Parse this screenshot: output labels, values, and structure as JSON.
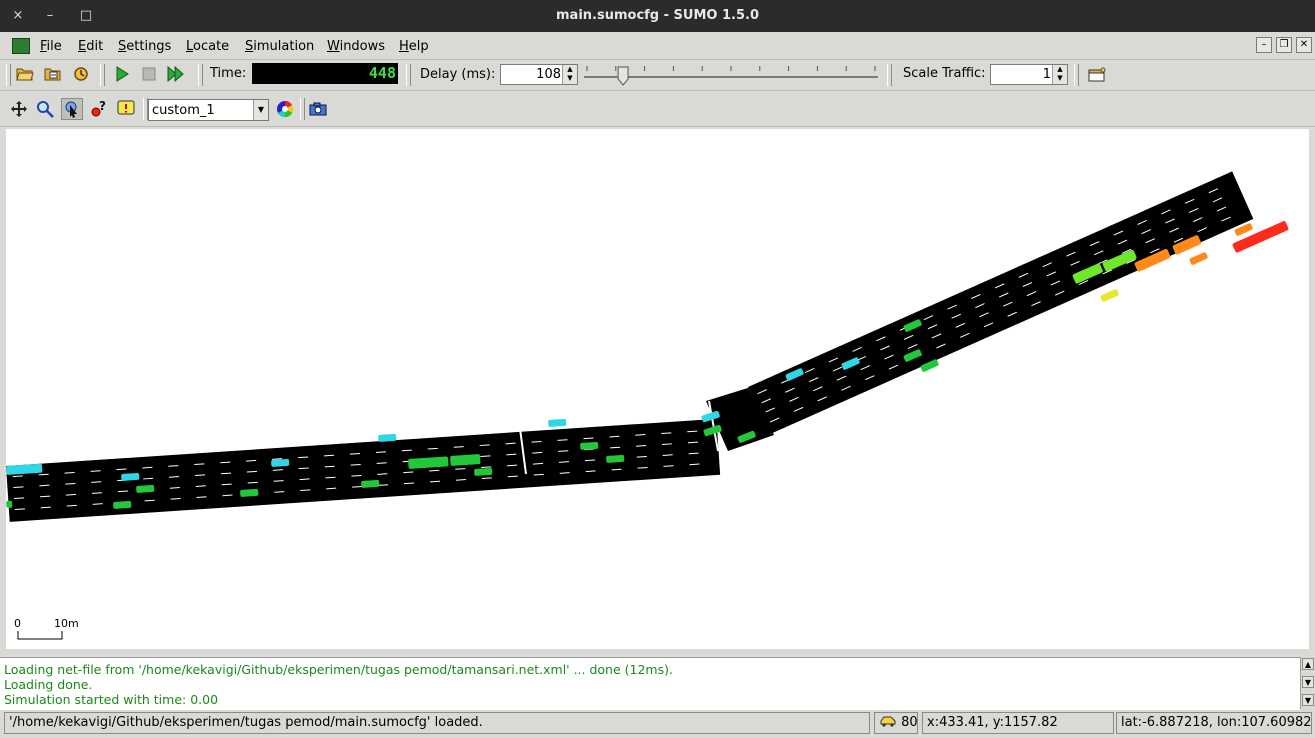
{
  "window": {
    "title": "main.sumocfg - SUMO 1.5.0",
    "close_glyph": "×",
    "minimize_glyph": "–",
    "maximize_glyph": "□"
  },
  "menu": {
    "items": [
      {
        "accel": "F",
        "rest": "ile"
      },
      {
        "accel": "E",
        "rest": "dit"
      },
      {
        "accel": "S",
        "rest": "ettings"
      },
      {
        "accel": "L",
        "rest": "ocate"
      },
      {
        "accel": "S",
        "rest": "imulation"
      },
      {
        "accel": "W",
        "rest": "indows"
      },
      {
        "accel": "H",
        "rest": "elp"
      }
    ],
    "mdi_minimize": "–",
    "mdi_restore": "❐",
    "mdi_close": "✕"
  },
  "toolbar": {
    "time_label": "Time:",
    "time_value": "448",
    "delay_label": "Delay (ms):",
    "delay_value": "108",
    "delay_slider_fraction": 0.12,
    "scale_label": "Scale Traffic:",
    "scale_value": "1"
  },
  "view_toolbar": {
    "scheme_value": "custom_1"
  },
  "canvas": {
    "scale_start": "0",
    "scale_end": "10m"
  },
  "log": {
    "lines": [
      "Loading net-file from '/home/kekavigi/Github/eksperimen/tugas pemod/tamansari.net.xml' ... done (12ms).",
      "Loading done.",
      "Simulation started with time: 0.00"
    ],
    "color": "#1a8a1a"
  },
  "statusbar": {
    "message": "'/home/kekavigi/Github/eksperimen/tugas pemod/main.sumocfg' loaded.",
    "vehicle_count": "80",
    "coords": "x:433.41, y:1157.82",
    "geo": "lat:-6.887218, lon:107.609822"
  },
  "colors": {
    "road": "#000000",
    "lane_marking": "#ffffff",
    "vehicle_green": "#22c73a",
    "vehicle_cyan": "#2fd6e6",
    "vehicle_orange": "#ff8a1a",
    "vehicle_red": "#ff2a1a",
    "vehicle_yellow": "#e8e82a",
    "vehicle_lime": "#6ee82a"
  }
}
